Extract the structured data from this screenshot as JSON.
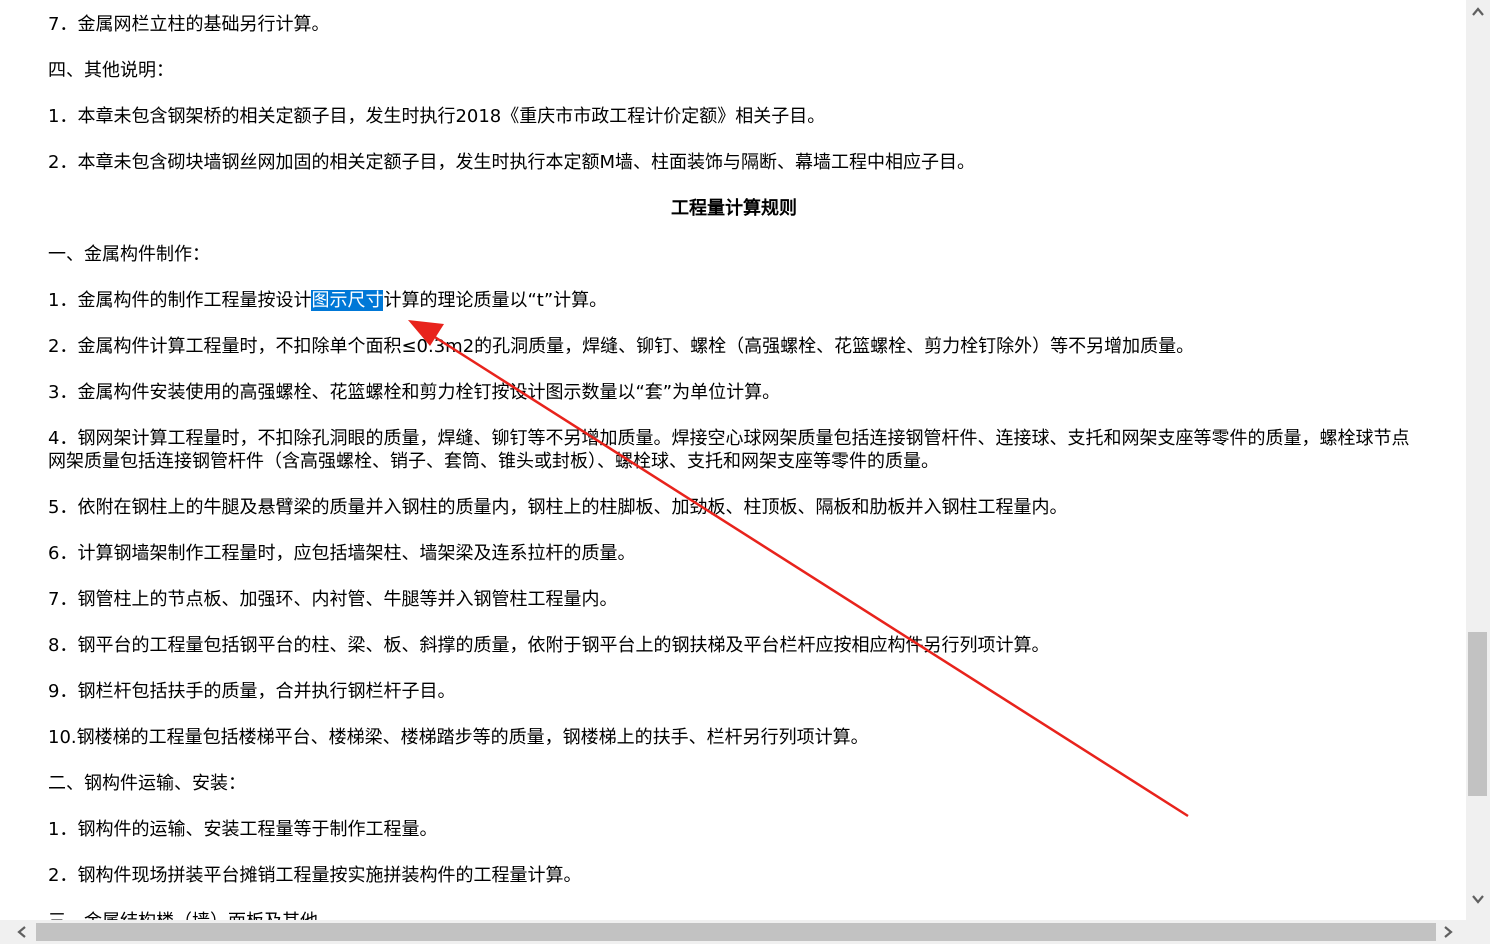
{
  "document": {
    "p1": "7．金属网栏立柱的基础另行计算。",
    "p2": "四、其他说明：",
    "p3": "1．本章未包含钢架桥的相关定额子目，发生时执行2018《重庆市市政工程计价定额》相关子目。",
    "p4": "2．本章未包含砌块墙钢丝网加固的相关定额子目，发生时执行本定额M墙、柱面装饰与隔断、幕墙工程中相应子目。",
    "heading": "工程量计算规则",
    "p5": "一、金属构件制作：",
    "p6_pre": "1．金属构件的制作工程量按设计",
    "p6_sel": "图示尺寸",
    "p6_post": "计算的理论质量以“t”计算。",
    "p7": "2．金属构件计算工程量时，不扣除单个面积≤0.3m2的孔洞质量，焊缝、铆钉、螺栓（高强螺栓、花篮螺栓、剪力栓钉除外）等不另增加质量。",
    "p8": "3．金属构件安装使用的高强螺栓、花篮螺栓和剪力栓钉按设计图示数量以“套”为单位计算。",
    "p9": "4．钢网架计算工程量时，不扣除孔洞眼的质量，焊缝、铆钉等不另增加质量。焊接空心球网架质量包括连接钢管杆件、连接球、支托和网架支座等零件的质量，螺栓球节点网架质量包括连接钢管杆件（含高强螺栓、销子、套筒、锥头或封板）、螺栓球、支托和网架支座等零件的质量。",
    "p10": "5．依附在钢柱上的牛腿及悬臂梁的质量并入钢柱的质量内，钢柱上的柱脚板、加劲板、柱顶板、隔板和肋板并入钢柱工程量内。",
    "p11": "6．计算钢墙架制作工程量时，应包括墙架柱、墙架梁及连系拉杆的质量。",
    "p12": "7．钢管柱上的节点板、加强环、内衬管、牛腿等并入钢管柱工程量内。",
    "p13": "8．钢平台的工程量包括钢平台的柱、梁、板、斜撑的质量，依附于钢平台上的钢扶梯及平台栏杆应按相应构件另行列项计算。",
    "p14": "9．钢栏杆包括扶手的质量，合并执行钢栏杆子目。",
    "p15": "10.钢楼梯的工程量包括楼梯平台、楼梯梁、楼梯踏步等的质量，钢楼梯上的扶手、栏杆另行列项计算。",
    "p16": "二、钢构件运输、安装：",
    "p17": "1．钢构件的运输、安装工程量等于制作工程量。",
    "p18": "2．钢构件现场拼装平台摊销工程量按实施拼装构件的工程量计算。",
    "p19": "三、金属结构楼（墙）面板及其他"
  },
  "scrollbars": {
    "up_icon": "chevron-up-icon",
    "down_icon": "chevron-down-icon",
    "left_icon": "chevron-left-icon",
    "right_icon": "chevron-right-icon"
  },
  "colors": {
    "selection": "#0078d7",
    "annotation_arrow": "#e8231c"
  }
}
